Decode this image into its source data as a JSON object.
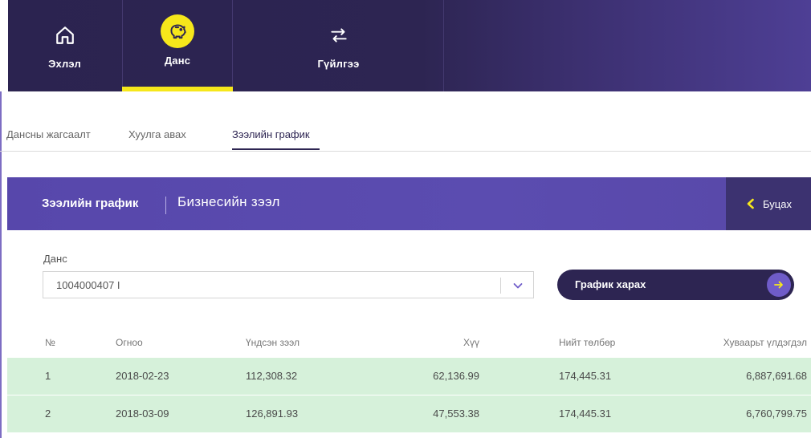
{
  "nav": {
    "items": [
      {
        "label": "Эхлэл",
        "icon": "home-icon"
      },
      {
        "label": "Данс",
        "icon": "piggy-bank-icon",
        "active": true
      },
      {
        "label": "Гүйлгээ",
        "icon": "transfer-arrows-icon"
      }
    ]
  },
  "subtabs": [
    {
      "label": "Дансны жагсаалт"
    },
    {
      "label": "Хуулга авах"
    },
    {
      "label": "Зээлийн график",
      "active": true
    }
  ],
  "section": {
    "title": "Зээлийн график",
    "subtitle": "Бизнесийн зээл",
    "back_label": "Буцах"
  },
  "form": {
    "account_label": "Данс",
    "account_value": "1004000407 I",
    "view_button_label": "График харах"
  },
  "table": {
    "headers": [
      "№",
      "Огноо",
      "Үндсэн зээл",
      "Хүү",
      "Нийт төлбөр",
      "Хуваарьт үлдэгдэл"
    ],
    "rows": [
      [
        "1",
        "2018-02-23",
        "112,308.32",
        "62,136.99",
        "174,445.31",
        "6,887,691.68"
      ],
      [
        "2",
        "2018-03-09",
        "126,891.93",
        "47,553.38",
        "174,445.31",
        "6,760,799.75"
      ]
    ]
  },
  "colors": {
    "nav_bg": "#2d2552",
    "accent_yellow": "#f6e71b",
    "header_purple": "#5747ab",
    "back_button_bg": "#3c3270",
    "row_green": "#d6f1da",
    "arrow_circle": "#6f5cc9"
  }
}
